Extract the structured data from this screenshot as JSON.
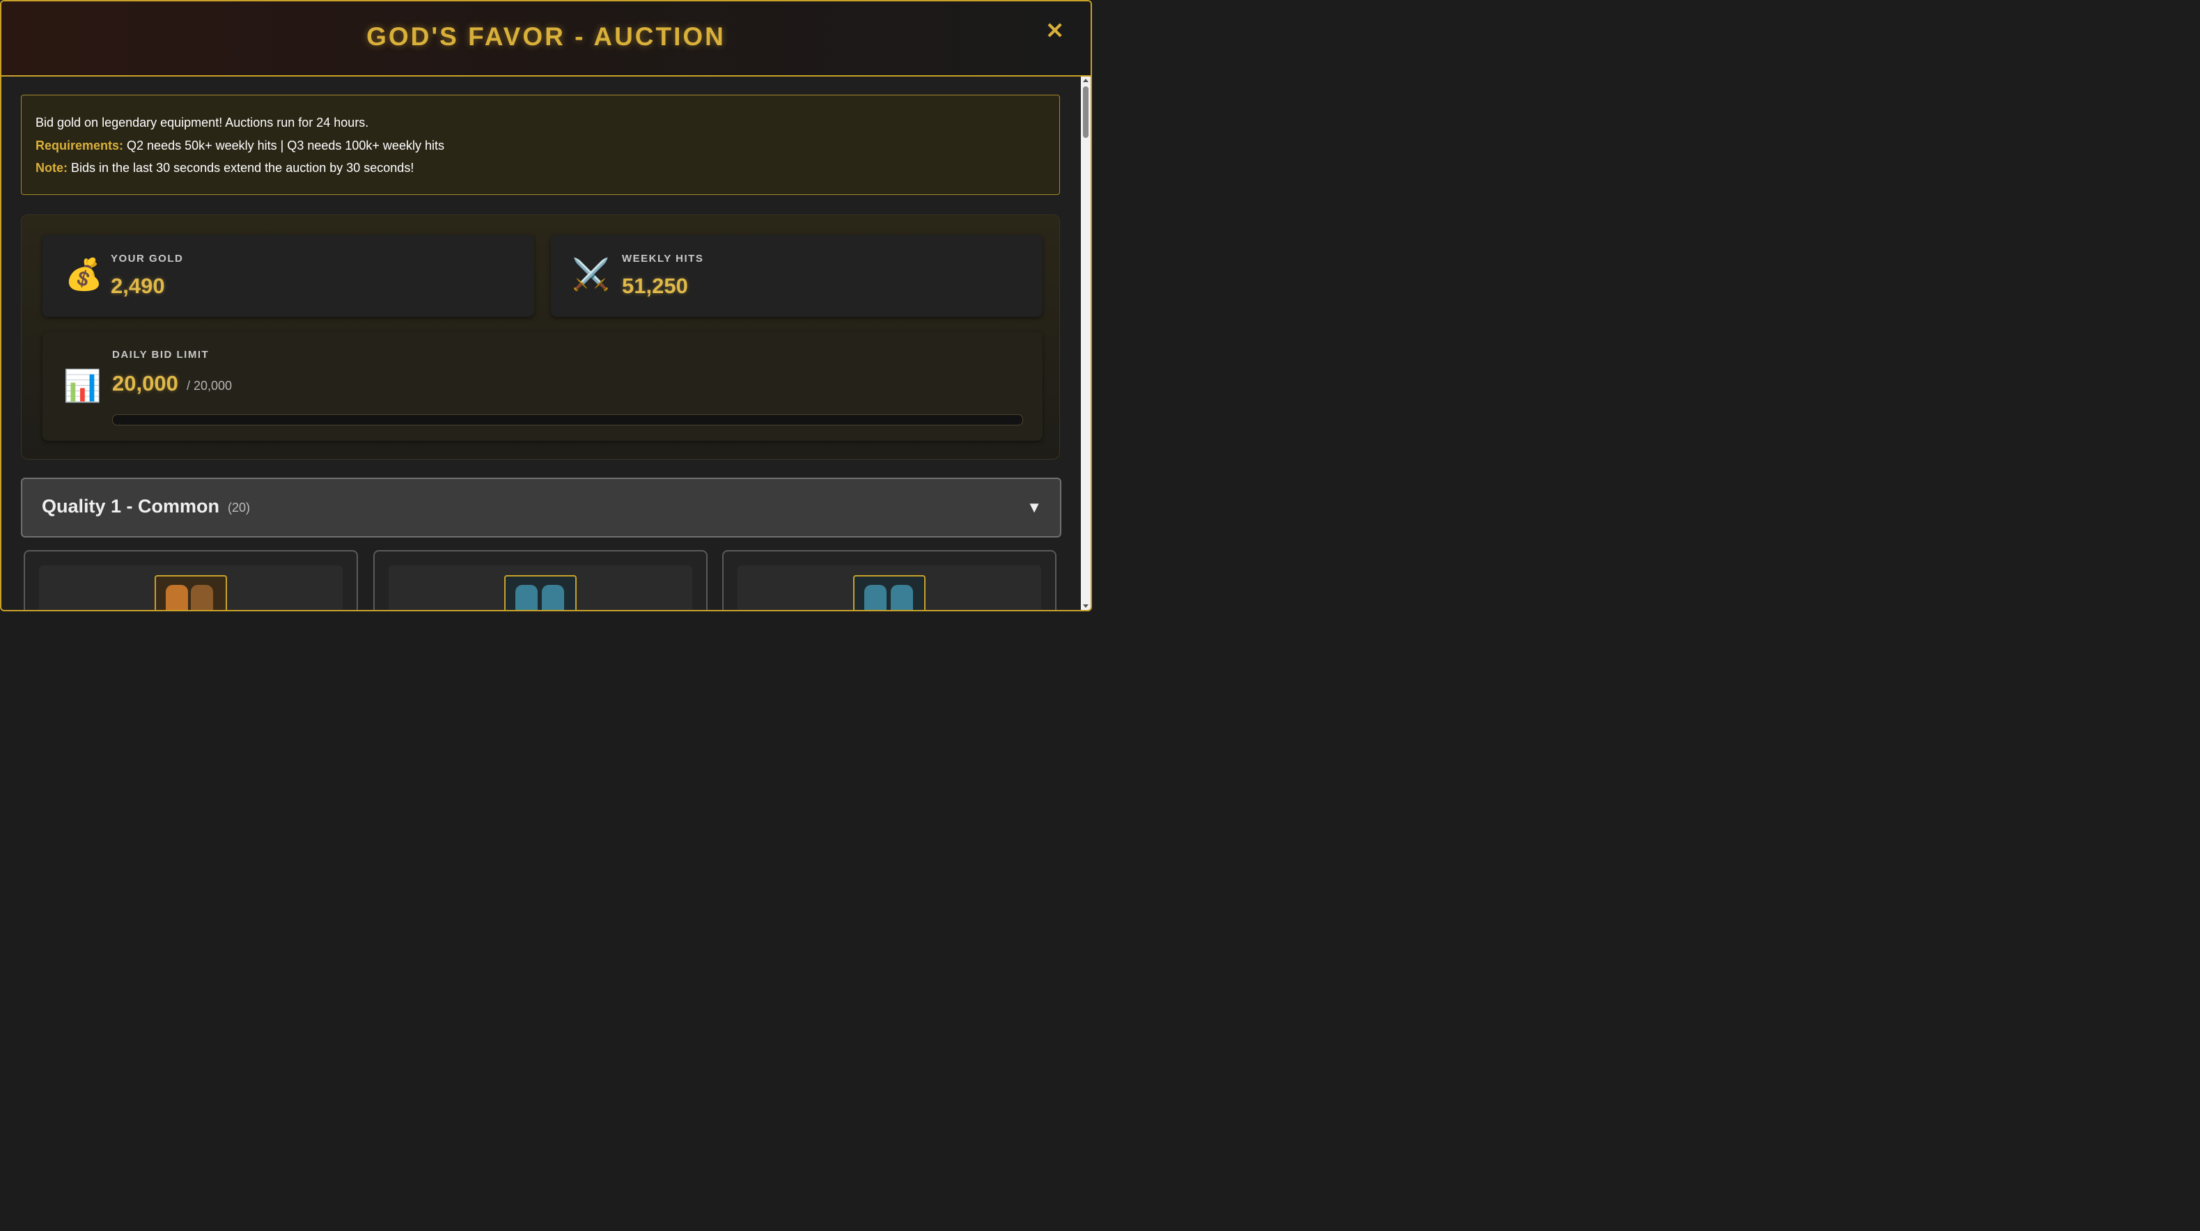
{
  "header": {
    "title": "GOD'S FAVOR - AUCTION",
    "close_label": "✕"
  },
  "info": {
    "line1": "Bid gold on legendary equipment! Auctions run for 24 hours.",
    "req_label": "Requirements:",
    "req_text": " Q2 needs 50k+ weekly hits | Q3 needs 100k+ weekly hits",
    "note_label": "Note:",
    "note_text": " Bids in the last 30 seconds extend the auction by 30 seconds!"
  },
  "stats": {
    "gold": {
      "icon": "money-bag-icon",
      "emoji": "💰",
      "label": "YOUR GOLD",
      "value": "2,490"
    },
    "hits": {
      "icon": "crossed-swords-icon",
      "emoji": "⚔️",
      "label": "WEEKLY HITS",
      "value": "51,250"
    },
    "limit": {
      "icon": "bar-chart-icon",
      "emoji": "📊",
      "label": "DAILY BID LIMIT",
      "value": "20,000",
      "max": "/ 20,000",
      "progress_fraction": 0.0
    }
  },
  "quality_section": {
    "name": "Quality 1 - Common",
    "count": "(20)",
    "chevron": "▼"
  },
  "items": [
    {
      "icon": "pants-armor-icon"
    },
    {
      "icon": "boots-armor-icon"
    },
    {
      "icon": "boots-armor-icon"
    }
  ],
  "colors": {
    "accent": "#d9b03a",
    "border": "#c9a227"
  }
}
